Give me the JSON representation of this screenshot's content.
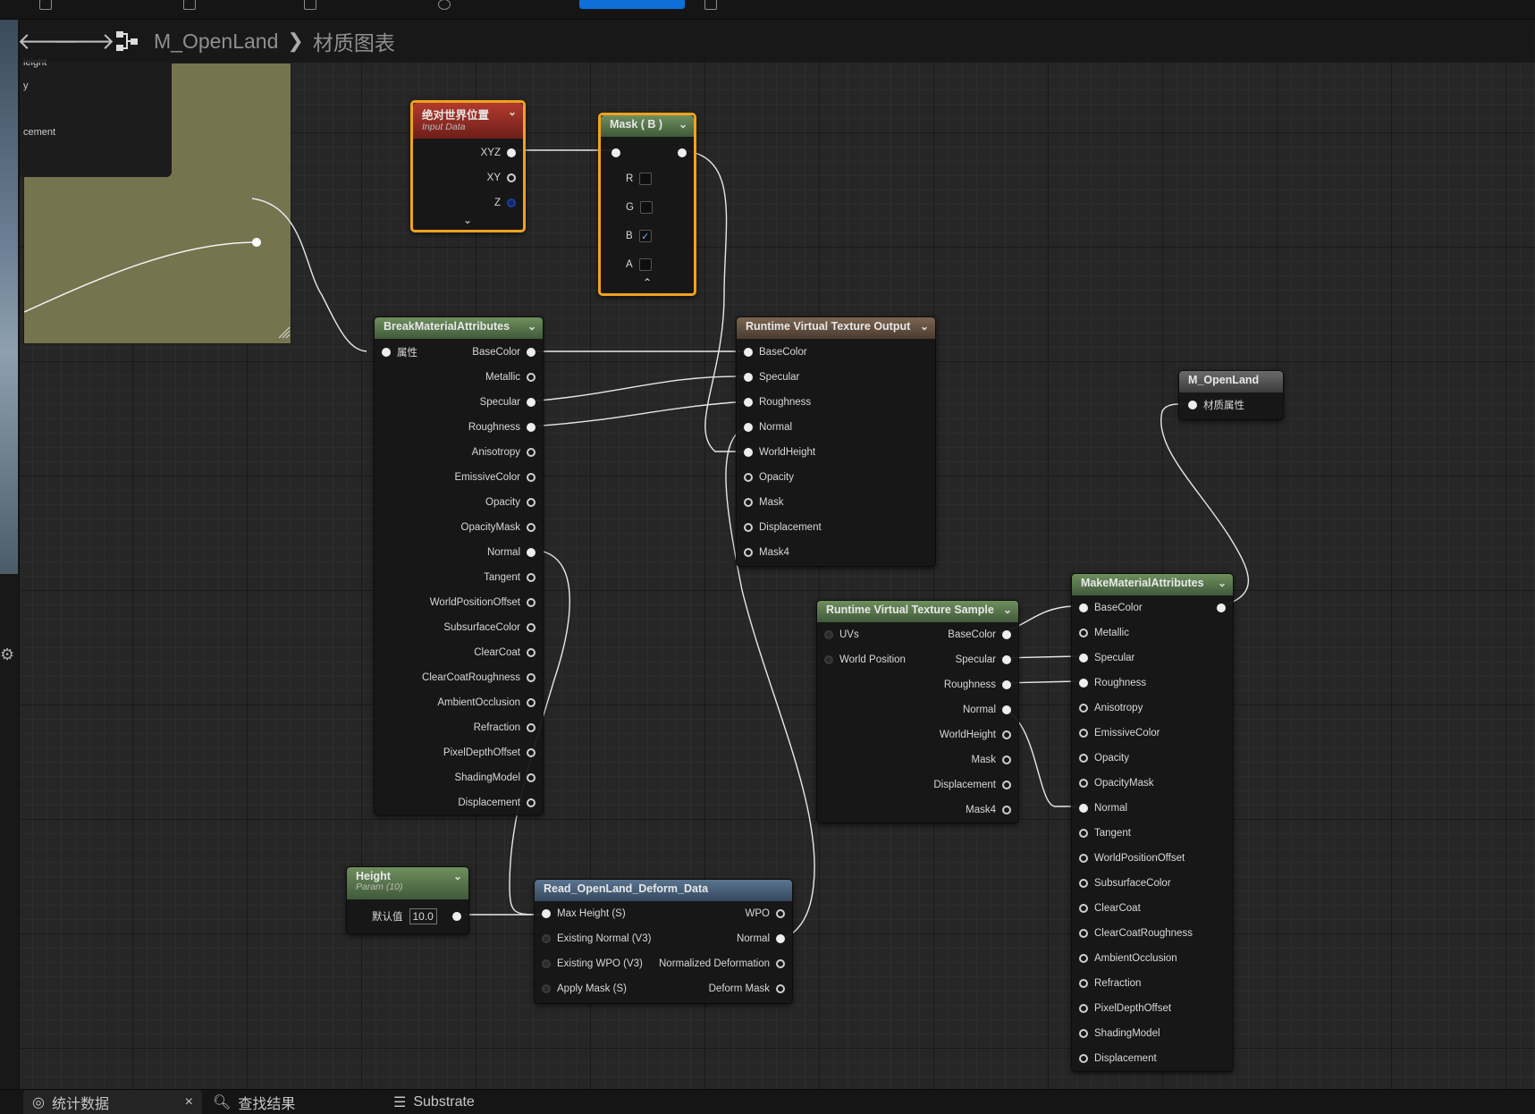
{
  "breadcrumb": {
    "asset": "M_OpenLand",
    "graph": "材质图表"
  },
  "details": {
    "lines": [
      "leight",
      "y",
      "cement"
    ]
  },
  "nodes": {
    "abs_world_pos": {
      "title": "绝对世界位置",
      "subtitle": "Input Data",
      "outputs": [
        "XYZ",
        "XY",
        "Z"
      ]
    },
    "mask_b": {
      "title": "Mask ( B )",
      "channels": [
        {
          "label": "R",
          "checked": ""
        },
        {
          "label": "G",
          "checked": ""
        },
        {
          "label": "B",
          "checked": "✓"
        },
        {
          "label": "A",
          "checked": ""
        }
      ]
    },
    "break_attrs": {
      "title": "BreakMaterialAttributes",
      "input": "属性",
      "outputs": [
        "BaseColor",
        "Metallic",
        "Specular",
        "Roughness",
        "Anisotropy",
        "EmissiveColor",
        "Opacity",
        "OpacityMask",
        "Normal",
        "Tangent",
        "WorldPositionOffset",
        "SubsurfaceColor",
        "ClearCoat",
        "ClearCoatRoughness",
        "AmbientOcclusion",
        "Refraction",
        "PixelDepthOffset",
        "ShadingModel",
        "Displacement"
      ]
    },
    "rvt_output": {
      "title": "Runtime Virtual Texture Output",
      "inputs": [
        "BaseColor",
        "Specular",
        "Roughness",
        "Normal",
        "WorldHeight",
        "Opacity",
        "Mask",
        "Displacement",
        "Mask4"
      ]
    },
    "m_openland": {
      "title": "M_OpenLand",
      "input": "材质属性"
    },
    "rvt_sample": {
      "title": "Runtime Virtual Texture Sample",
      "inputs": [
        "UVs",
        "World Position"
      ],
      "outputs": [
        "BaseColor",
        "Specular",
        "Roughness",
        "Normal",
        "WorldHeight",
        "Mask",
        "Displacement",
        "Mask4"
      ]
    },
    "make_attrs": {
      "title": "MakeMaterialAttributes",
      "inputs": [
        "BaseColor",
        "Metallic",
        "Specular",
        "Roughness",
        "Anisotropy",
        "EmissiveColor",
        "Opacity",
        "OpacityMask",
        "Normal",
        "Tangent",
        "WorldPositionOffset",
        "SubsurfaceColor",
        "ClearCoat",
        "ClearCoatRoughness",
        "AmbientOcclusion",
        "Refraction",
        "PixelDepthOffset",
        "ShadingModel",
        "Displacement"
      ]
    },
    "height_param": {
      "title": "Height",
      "subtitle": "Param (10)",
      "default_label": "默认值",
      "default_value": "10.0"
    },
    "read_deform": {
      "title": "Read_OpenLand_Deform_Data",
      "inputs": [
        "Max Height (S)",
        "Existing Normal (V3)",
        "Existing WPO (V3)",
        "Apply Mask (S)"
      ],
      "outputs": [
        "WPO",
        "Normal",
        "Normalized Deformation",
        "Deform Mask"
      ]
    }
  },
  "bottom_tabs": [
    {
      "label": "统计数据",
      "close": "×"
    },
    {
      "label": "查找结果"
    },
    {
      "label": "Substrate"
    }
  ],
  "colors": {
    "selection": "#f0a21e",
    "node_green": "#5a7a4c",
    "node_red": "#a33a2e",
    "node_brown": "#6a5444"
  }
}
